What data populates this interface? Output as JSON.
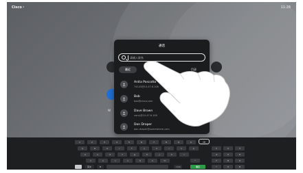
{
  "topbar": {
    "brand": "Cisco",
    "chevron": "›",
    "time": "11:28"
  },
  "home": {
    "buttons": [
      {
        "name": "home-button-call",
        "label": ""
      },
      {
        "name": "home-button-share",
        "label": ""
      },
      {
        "name": "home-button-webex",
        "label": "W"
      },
      {
        "name": "home-button-right",
        "label": ""
      }
    ]
  },
  "dialog": {
    "title": "通话",
    "search": {
      "placeholder": "请输入联系",
      "value": ""
    },
    "tabs": [
      {
        "label": "最近"
      },
      {
        "label": "收"
      },
      {
        "label": "目录"
      }
    ],
    "contacts": [
      {
        "name": "Anita Poscotto",
        "detail": "74143@10.47.6.108"
      },
      {
        "name": "Bob",
        "detail": "bob@cisco.com"
      },
      {
        "name": "Dave Brown",
        "detail": "vorry@10.47.6.108"
      },
      {
        "name": "Don Draper",
        "detail": "don.draper@somewhere.com"
      }
    ]
  },
  "keyboard": {
    "row1": [
      "1",
      "2",
      "3",
      "4",
      "5",
      "6",
      "7",
      "8",
      "9",
      "0",
      "⌫"
    ],
    "row2": [
      "q",
      "w",
      "e",
      "r",
      "t",
      "y",
      "u",
      "i",
      "o",
      "p"
    ],
    "row3": [
      "a",
      "s",
      "d",
      "f",
      "g",
      "h",
      "j",
      "k",
      "l"
    ],
    "row4": [
      "z",
      "x",
      "c",
      "v",
      "b",
      "n",
      "m",
      "^"
    ],
    "bottom": {
      "mode": "英文",
      "settings": "⚙",
      "space": "",
      "dotcom": ".com",
      "go": "确定"
    },
    "numpad": [
      "1",
      "2",
      "3",
      "4",
      "5",
      "6",
      "7",
      "8",
      "9",
      "*",
      "0",
      "#"
    ],
    "numpad_sub": [
      "",
      "abc",
      "def",
      "ghi",
      "jkl",
      "mno",
      "pqrs",
      "tuv",
      "wxyz",
      "",
      "",
      ""
    ],
    "colors": {
      "go": "#2f9a4a"
    }
  },
  "icons": [
    "search-icon",
    "avatar-icon",
    "keyboard-icon",
    "gear-icon",
    "backspace-icon",
    "pointing-hand-icon"
  ]
}
